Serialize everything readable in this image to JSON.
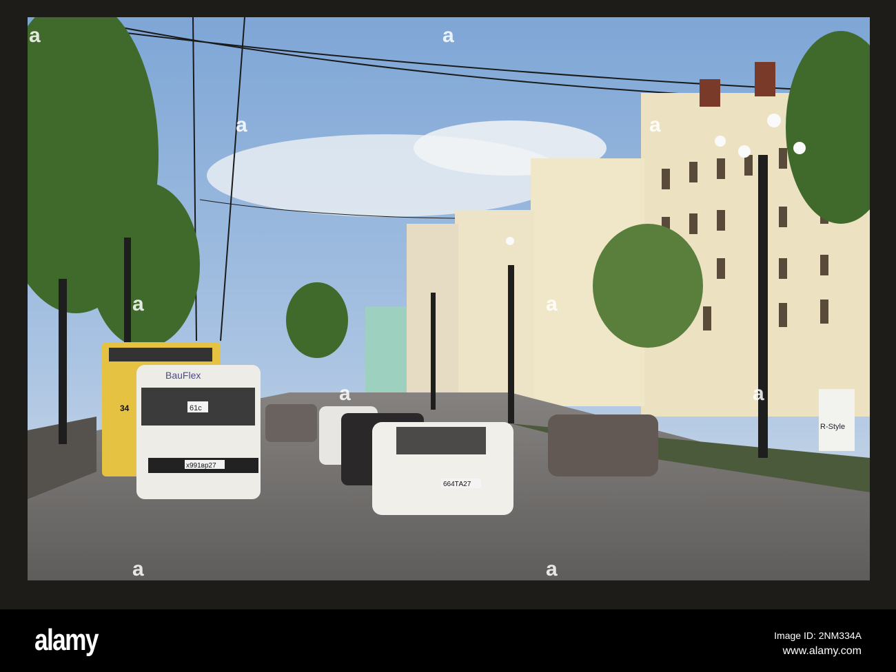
{
  "photo": {
    "van_brand": "BauFlex",
    "van_route": "61c",
    "bus_route": "34",
    "van_plate": "х991вр27",
    "car_plate": "664ТА27",
    "store_sign": "R-Style"
  },
  "watermark": {
    "logo": "alamy",
    "image_id": "Image ID: 2NM334A",
    "website": "www.alamy.com",
    "tile": "a"
  },
  "colors": {
    "sky": "#8fb4dc",
    "building": "#ece2c2",
    "road": "#6d6b69",
    "frame": "#1d1c19"
  }
}
